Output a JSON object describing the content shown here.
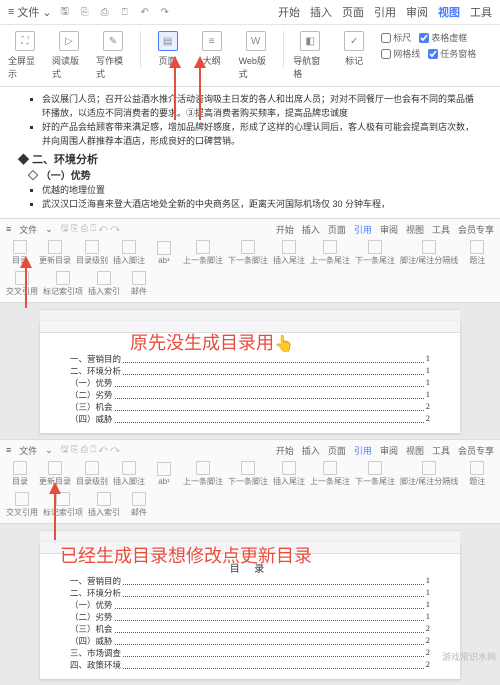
{
  "header": {
    "file_menu": "文件",
    "menu_tabs": [
      "开始",
      "插入",
      "页面",
      "引用",
      "审阅",
      "视图",
      "工具"
    ],
    "active_tab": "视图"
  },
  "ribbon_main": {
    "group1": [
      {
        "icon": "⛶",
        "label": "全屏显示"
      },
      {
        "icon": "▷",
        "label": "阅读版式"
      },
      {
        "icon": "✎",
        "label": "写作模式"
      }
    ],
    "group2": [
      {
        "icon": "▤",
        "label": "页面"
      },
      {
        "icon": "≡",
        "label": "大纲"
      },
      {
        "icon": "W",
        "label": "Web版式"
      }
    ],
    "group3": [
      {
        "icon": "◧",
        "label": "导航窗格"
      }
    ],
    "group4": [
      {
        "icon": "✓",
        "label": "标记"
      }
    ],
    "checks": [
      {
        "label": "标尺",
        "checked": false
      },
      {
        "label": "表格虚框",
        "checked": true
      },
      {
        "label": "网格线",
        "checked": false
      },
      {
        "label": "任务窗格",
        "checked": true
      }
    ]
  },
  "document_text": {
    "bullet1": "会议展门人员；召开公益酒水推介活动咨询吸主日发的各人和出席人员；对对不同餐厅一也会有不同的菜品循环播放，以适应不同消费者的要求。③提高消费者购买频率，提高品牌忠诚度",
    "bullet2": "好的产品会给顾客带来满足感，增加品牌好感度，形成了这样的心理认同后，客人极有可能会提高到店次数，并向周围人群推荐本酒店，形成良好的口碑营销。",
    "h2": "二、环境分析",
    "h3": "（一）优势",
    "bullet3": "优越的地理位置",
    "bullet4": "武汉汉口泛海喜来登大酒店地处全新的中央商务区，距离天河国际机场仅 30 分钟车程，"
  },
  "sub_ribbon": {
    "row1_left": "文件",
    "row1_tabs": [
      "开始",
      "插入",
      "页面",
      "引用",
      "审阅",
      "视图",
      "工具",
      "会员专享"
    ],
    "row1_active": "引用",
    "row2": [
      "目录",
      "更新目录",
      "目录级别",
      "插入脚注",
      "ab¹",
      "上一条脚注",
      "下一条脚注",
      "插入尾注",
      "上一条尾注",
      "下一条尾注",
      "脚注/尾注分隔线",
      "题注",
      "交叉引用",
      "标记索引项",
      "插入索引",
      "邮件"
    ]
  },
  "annotation1": "原先没生成目录用",
  "toc1": [
    {
      "t": "一、营销目的",
      "p": "1"
    },
    {
      "t": "二、环境分析",
      "p": "1"
    },
    {
      "t": "（一）优势",
      "p": "1"
    },
    {
      "t": "（二）劣势",
      "p": "1"
    },
    {
      "t": "（三）机会",
      "p": "2"
    },
    {
      "t": "（四）威胁",
      "p": "2"
    }
  ],
  "annotation2": "已经生成目录想修改点更新目录",
  "toc2_title": "目 录",
  "toc2": [
    {
      "t": "一、营销目的",
      "p": "1"
    },
    {
      "t": "二、环境分析",
      "p": "1"
    },
    {
      "t": "（一）优势",
      "p": "1"
    },
    {
      "t": "（二）劣势",
      "p": "1"
    },
    {
      "t": "（三）机会",
      "p": "2"
    },
    {
      "t": "（四）威胁",
      "p": "2"
    },
    {
      "t": "三、市场调查",
      "p": "2"
    },
    {
      "t": "四、政策环境",
      "p": "2"
    }
  ],
  "watermark": "游戏常识水网"
}
